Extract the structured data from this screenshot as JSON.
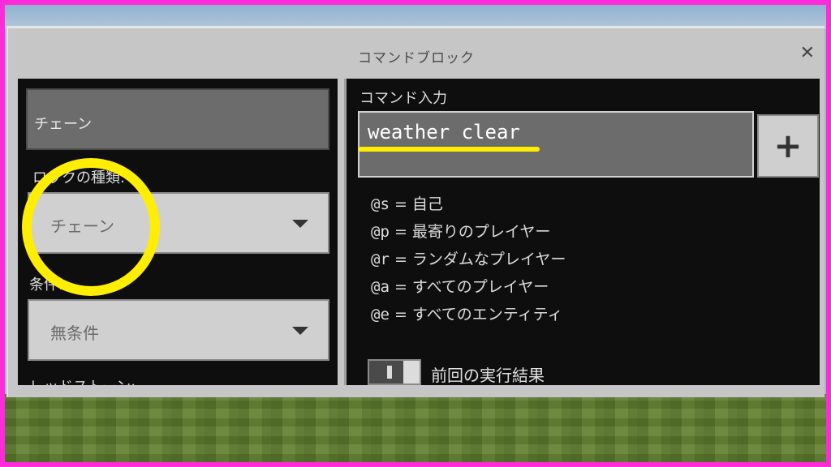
{
  "window": {
    "title": "コマンドブロック",
    "close_label": "✕"
  },
  "left": {
    "name_value": "チェーン",
    "block_type_label": "ロックの種類:",
    "block_type_value": "チェーン",
    "condition_label": "条件:",
    "condition_value": "無条件",
    "cut_label": "レッドストーン:"
  },
  "right": {
    "command_label": "コマンド入力",
    "command_value": "weather clear",
    "add_button_label": "+",
    "help": [
      {
        "code": "@s",
        "text": "= 自己"
      },
      {
        "code": "@p",
        "text": "= 最寄りのプレイヤー"
      },
      {
        "code": "@r",
        "text": "= ランダムなプレイヤー"
      },
      {
        "code": "@a",
        "text": "= すべてのプレイヤー"
      },
      {
        "code": "@e",
        "text": "= すべてのエンティティ"
      }
    ],
    "previous_output_label": "前回の実行結果"
  },
  "colors": {
    "highlight": "#ffee00",
    "border_outer": "#ff2bd8"
  }
}
